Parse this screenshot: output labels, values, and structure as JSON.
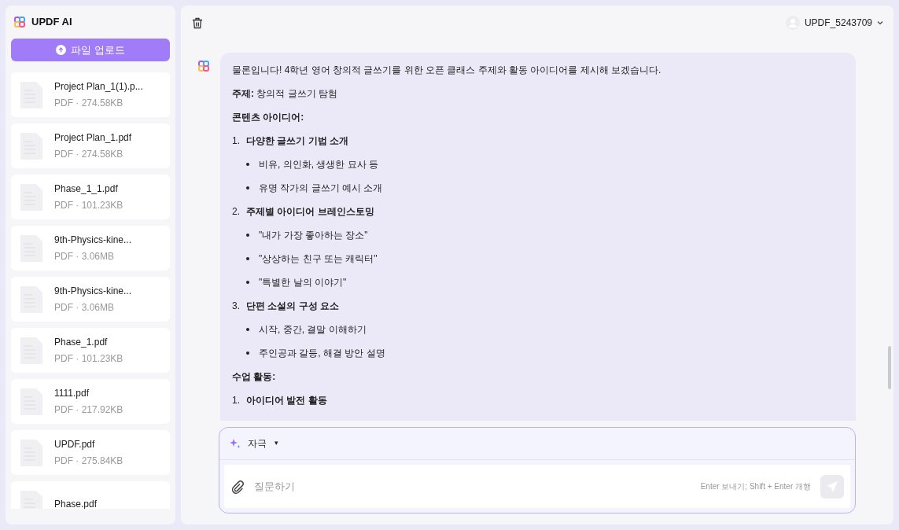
{
  "app": {
    "title": "UPDF AI",
    "upload_button": "파일 업로드"
  },
  "files": [
    {
      "name": "Project Plan_1(1).p...",
      "meta": "PDF · 274.58KB"
    },
    {
      "name": "Project Plan_1.pdf",
      "meta": "PDF · 274.58KB"
    },
    {
      "name": "Phase_1_1.pdf",
      "meta": "PDF · 101.23KB"
    },
    {
      "name": "9th-Physics-kine...",
      "meta": "PDF · 3.06MB"
    },
    {
      "name": "9th-Physics-kine...",
      "meta": "PDF · 3.06MB"
    },
    {
      "name": "Phase_1.pdf",
      "meta": "PDF · 101.23KB"
    },
    {
      "name": "1111.pdf",
      "meta": "PDF · 217.92KB"
    },
    {
      "name": "UPDF.pdf",
      "meta": "PDF · 275.84KB"
    },
    {
      "name": "Phase.pdf"
    }
  ],
  "user": {
    "name": "UPDF_5243709"
  },
  "message": [
    {
      "kind": "paragraph",
      "text": "물론입니다! 4학년 영어 창의적 글쓰기를 위한 오픈 클래스 주제와 활동 아이디어를 제시해 보겠습니다."
    },
    {
      "kind": "paragraph",
      "text": "**주제:** 창의적 글쓰기 탐험"
    },
    {
      "kind": "heading",
      "text": "콘텐츠 아이디어:"
    },
    {
      "kind": "numbered",
      "number": "1.",
      "text": "다양한 글쓰기 기법 소개"
    },
    {
      "kind": "bullet",
      "text": "비유, 의인화, 생생한 묘사 등"
    },
    {
      "kind": "bullet",
      "text": "유명 작가의 글쓰기 예시 소개"
    },
    {
      "kind": "numbered",
      "number": "2.",
      "text": "주제별 아이디어 브레인스토밍"
    },
    {
      "kind": "bullet",
      "text": "\"내가 가장 좋아하는 장소\""
    },
    {
      "kind": "bullet",
      "text": "\"상상하는 친구 또는 캐릭터\""
    },
    {
      "kind": "bullet",
      "text": "\"특별한 날의 이야기\""
    },
    {
      "kind": "numbered",
      "number": "3.",
      "text": "단편 소설의 구성 요소"
    },
    {
      "kind": "bullet",
      "text": "시작, 중간, 결말 이해하기"
    },
    {
      "kind": "bullet",
      "text": "주인공과 갈등, 해결 방안 설명"
    },
    {
      "kind": "heading",
      "text": "수업 활동:"
    },
    {
      "kind": "numbered",
      "number": "1.",
      "text": "아이디어 발전 활동"
    }
  ],
  "composer": {
    "mode": "자극",
    "mode_caret": "▾",
    "placeholder": "질문하기",
    "hint": "Enter 보내기; Shift + Enter 개행"
  }
}
